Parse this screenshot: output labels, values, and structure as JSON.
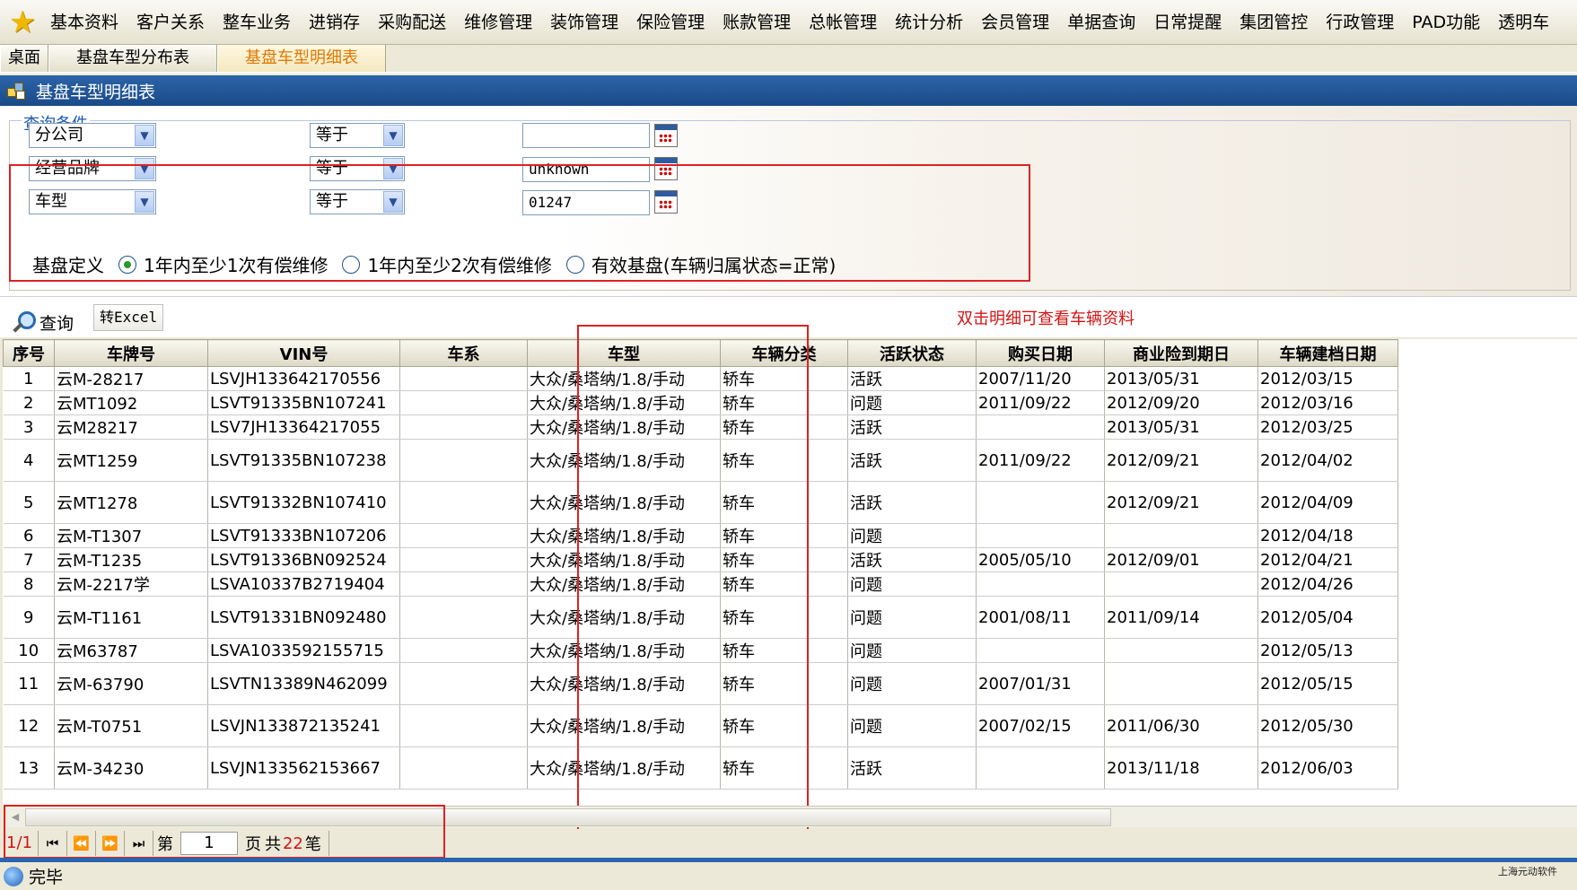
{
  "menu": [
    "基本资料",
    "客户关系",
    "整车业务",
    "进销存",
    "采购配送",
    "维修管理",
    "装饰管理",
    "保险管理",
    "账款管理",
    "总帐管理",
    "统计分析",
    "会员管理",
    "单据查询",
    "日常提醒",
    "集团管控",
    "行政管理",
    "PAD功能",
    "透明车"
  ],
  "tabs": [
    "桌面",
    "基盘车型分布表",
    "基盘车型明细表"
  ],
  "window_title": "基盘车型明细表",
  "query": {
    "legend": "查询条件",
    "rows": [
      {
        "field": "分公司",
        "op": "等于",
        "value": ""
      },
      {
        "field": "经营品牌",
        "op": "等于",
        "value": "unknown"
      },
      {
        "field": "车型",
        "op": "等于",
        "value": "01247"
      }
    ],
    "base_label": "基盘定义",
    "radios": [
      {
        "label": "1年内至少1次有偿维修",
        "checked": true
      },
      {
        "label": "1年内至少2次有偿维修",
        "checked": false
      },
      {
        "label": "有效基盘(车辆归属状态=正常)",
        "checked": false
      }
    ]
  },
  "toolbar": {
    "query_label": "查询",
    "excel_label": "转Excel",
    "hint": "双击明细可查看车辆资料"
  },
  "table": {
    "columns": [
      "序号",
      "车牌号",
      "VIN号",
      "车系",
      "车型",
      "车辆分类",
      "活跃状态",
      "购买日期",
      "商业险到期日",
      "车辆建档日期"
    ],
    "rows": [
      [
        "1",
        "云M-28217",
        "LSVJH133642170556",
        "",
        "大众/桑塔纳/1.8/手动",
        "轿车",
        "活跃",
        "2007/11/20",
        "2013/05/31",
        "2012/03/15"
      ],
      [
        "2",
        "云MT1092",
        "LSVT91335BN107241",
        "",
        "大众/桑塔纳/1.8/手动",
        "轿车",
        "问题",
        "2011/09/22",
        "2012/09/20",
        "2012/03/16"
      ],
      [
        "3",
        "云M28217",
        "LSV7JH13364217055",
        "",
        "大众/桑塔纳/1.8/手动",
        "轿车",
        "活跃",
        "",
        "2013/05/31",
        "2012/03/25"
      ],
      [
        "4",
        "云MT1259",
        "LSVT91335BN107238",
        "",
        "大众/桑塔纳/1.8/手动",
        "轿车",
        "活跃",
        "2011/09/22",
        "2012/09/21",
        "2012/04/02"
      ],
      [
        "5",
        "云MT1278",
        "LSVT91332BN107410",
        "",
        "大众/桑塔纳/1.8/手动",
        "轿车",
        "活跃",
        "",
        "2012/09/21",
        "2012/04/09"
      ],
      [
        "6",
        "云M-T1307",
        "LSVT91333BN107206",
        "",
        "大众/桑塔纳/1.8/手动",
        "轿车",
        "问题",
        "",
        "",
        "2012/04/18"
      ],
      [
        "7",
        "云M-T1235",
        "LSVT91336BN092524",
        "",
        "大众/桑塔纳/1.8/手动",
        "轿车",
        "活跃",
        "2005/05/10",
        "2012/09/01",
        "2012/04/21"
      ],
      [
        "8",
        "云M-2217学",
        "LSVA10337B2719404",
        "",
        "大众/桑塔纳/1.8/手动",
        "轿车",
        "问题",
        "",
        "",
        "2012/04/26"
      ],
      [
        "9",
        "云M-T1161",
        "LSVT91331BN092480",
        "",
        "大众/桑塔纳/1.8/手动",
        "轿车",
        "问题",
        "2001/08/11",
        "2011/09/14",
        "2012/05/04"
      ],
      [
        "10",
        "云M63787",
        "LSVA1033592155715",
        "",
        "大众/桑塔纳/1.8/手动",
        "轿车",
        "问题",
        "",
        "",
        "2012/05/13"
      ],
      [
        "11",
        "云M-63790",
        "LSVTN13389N462099",
        "",
        "大众/桑塔纳/1.8/手动",
        "轿车",
        "问题",
        "2007/01/31",
        "",
        "2012/05/15"
      ],
      [
        "12",
        "云M-T0751",
        "LSVJN133872135241",
        "",
        "大众/桑塔纳/1.8/手动",
        "轿车",
        "问题",
        "2007/02/15",
        "2011/06/30",
        "2012/05/30"
      ],
      [
        "13",
        "云M-34230",
        "LSVJN133562153667",
        "",
        "大众/桑塔纳/1.8/手动",
        "轿车",
        "活跃",
        "",
        "2013/11/18",
        "2012/06/03"
      ]
    ]
  },
  "pager": {
    "page_info": "1/1",
    "prefix": "第",
    "page": "1",
    "suffix": "页",
    "total_prefix": "共",
    "total": "22",
    "total_suffix": "笔"
  },
  "status": {
    "text": "完毕",
    "corp": "上海元动软件"
  }
}
